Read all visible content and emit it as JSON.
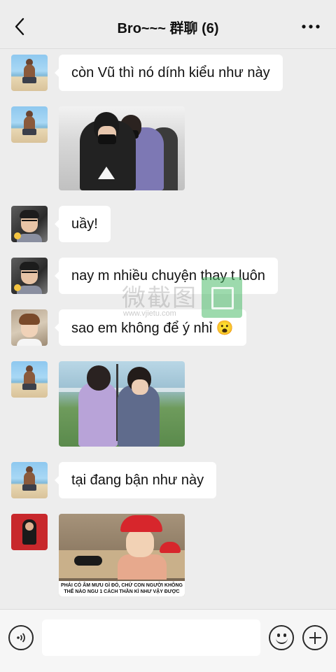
{
  "header": {
    "title": "Bro~~~ 群聊 (6)",
    "back_icon": "chevron-left-icon",
    "more_icon": "more-dots-icon"
  },
  "messages": [
    {
      "type": "text",
      "avatar": "beach-avatar",
      "text": "còn Vũ thì nó dính kiểu như này"
    },
    {
      "type": "image",
      "avatar": "beach-avatar",
      "image": "photo-two-men-masks"
    },
    {
      "type": "text",
      "avatar": "glasses-avatar",
      "text": "uầy!"
    },
    {
      "type": "text",
      "avatar": "glasses-avatar",
      "text": "nay m nhiều chuyện thay t luôn"
    },
    {
      "type": "text",
      "avatar": "boy-avatar",
      "text": "sao em không để ý nhỉ 😮"
    },
    {
      "type": "image",
      "avatar": "beach-avatar",
      "image": "photo-two-men-outdoor"
    },
    {
      "type": "text",
      "avatar": "beach-avatar",
      "text": "tại đang bận như này"
    },
    {
      "type": "image",
      "avatar": "red-avatar",
      "image": "meme-kid-red-hat",
      "caption": "PHẢI CÓ ÂM MƯU GÌ ĐÓ, CHỨ CON NGƯỜI KHÔNG THỂ NÀO NGU 1 CÁCH THẦN KÌ NHƯ VẬY ĐƯỢC"
    }
  ],
  "watermark": {
    "text": "微截图",
    "url": "www.vjietu.com"
  },
  "composer": {
    "input_value": "",
    "voice_icon": "voice-icon",
    "emoji_icon": "emoji-icon",
    "plus_icon": "plus-circle-icon"
  }
}
